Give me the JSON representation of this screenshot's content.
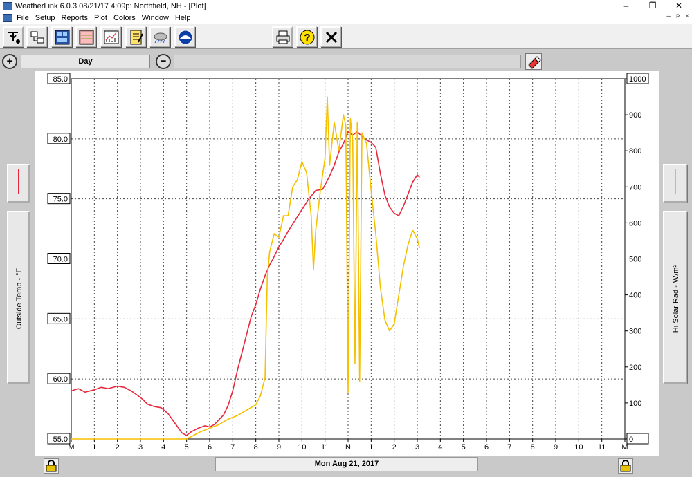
{
  "window": {
    "title": "WeatherLink 6.0.3  08/21/17   4:09p: Northfield, NH - [Plot]",
    "minimize": "–",
    "restore": "❐",
    "close": "✕"
  },
  "menu": {
    "items": [
      "File",
      "Setup",
      "Reports",
      "Plot",
      "Colors",
      "Window",
      "Help"
    ],
    "child_controls": [
      "–",
      "ᴘ",
      "×"
    ]
  },
  "toolbar": {
    "icons": [
      "station-pointer-icon",
      "network-icon",
      "bulletin-icon",
      "browse-table-icon",
      "plot-icon",
      "notes-icon",
      "weather-cloud-icon",
      "noaa-icon",
      "print-icon",
      "help-icon",
      "close-icon"
    ]
  },
  "range": {
    "zoom_in": "+",
    "zoom_out": "−",
    "period": "Day",
    "range_value": ""
  },
  "left_panel": {
    "label": "Outside Temp - °F",
    "color": "#e8283c"
  },
  "right_panel": {
    "label": "Hi Solar Rad - W/m²",
    "color": "#f5c000"
  },
  "date": "Mon Aug 21, 2017",
  "colors": {
    "temp": "#e8283c",
    "solar": "#f5c000",
    "grid": "#444444"
  },
  "chart_data": {
    "type": "line",
    "x_tick_labels": [
      "M",
      "1",
      "2",
      "3",
      "4",
      "5",
      "6",
      "7",
      "8",
      "9",
      "10",
      "11",
      "N",
      "1",
      "2",
      "3",
      "4",
      "5",
      "6",
      "7",
      "8",
      "9",
      "10",
      "11",
      "M"
    ],
    "x_unit": "hour of day",
    "xlim": [
      0,
      24
    ],
    "y_left": {
      "label": "Outside Temp - °F",
      "ylim": [
        55,
        85
      ],
      "ticks": [
        "55.0",
        "60.0",
        "65.0",
        "70.0",
        "75.0",
        "80.0",
        "85.0"
      ]
    },
    "y_right": {
      "label": "Hi Solar Rad - W/m²",
      "ylim": [
        0,
        1000
      ],
      "ticks": [
        "0",
        "100",
        "200",
        "300",
        "400",
        "500",
        "600",
        "700",
        "800",
        "900",
        "1000"
      ]
    },
    "grid": true,
    "series": [
      {
        "name": "Outside Temp - °F",
        "axis": "left",
        "color": "#e8283c",
        "x": [
          0.0,
          0.3,
          0.6,
          1.0,
          1.3,
          1.6,
          2.0,
          2.3,
          2.6,
          2.9,
          3.1,
          3.3,
          3.6,
          3.9,
          4.2,
          4.5,
          4.8,
          5.0,
          5.2,
          5.5,
          5.8,
          6.0,
          6.2,
          6.4,
          6.6,
          6.8,
          7.0,
          7.2,
          7.4,
          7.6,
          7.8,
          8.0,
          8.2,
          8.4,
          8.6,
          8.8,
          9.0,
          9.2,
          9.4,
          9.6,
          9.8,
          10.0,
          10.3,
          10.6,
          10.9,
          11.2,
          11.4,
          11.6,
          11.8,
          12.0,
          12.2,
          12.4,
          12.6,
          12.8,
          13.0,
          13.2,
          13.4,
          13.6,
          13.8,
          14.0,
          14.2,
          14.4,
          14.6,
          14.8,
          15.0,
          15.1
        ],
        "values": [
          59.0,
          59.2,
          58.9,
          59.1,
          59.3,
          59.2,
          59.4,
          59.3,
          59.0,
          58.6,
          58.3,
          57.9,
          57.7,
          57.6,
          57.1,
          56.3,
          55.5,
          55.3,
          55.6,
          55.9,
          56.1,
          56.0,
          56.2,
          56.6,
          57.0,
          57.8,
          59.0,
          60.7,
          62.2,
          63.7,
          65.2,
          66.2,
          67.5,
          68.6,
          69.5,
          70.2,
          71.0,
          71.6,
          72.3,
          72.9,
          73.5,
          74.1,
          75.0,
          75.7,
          75.8,
          76.9,
          77.8,
          78.9,
          79.6,
          80.6,
          80.3,
          80.6,
          80.2,
          79.9,
          79.7,
          79.3,
          77.1,
          75.3,
          74.3,
          73.8,
          73.6,
          74.4,
          75.4,
          76.4,
          77.0,
          76.8
        ]
      },
      {
        "name": "Hi Solar Rad - W/m²",
        "axis": "right",
        "color": "#f5c000",
        "x": [
          0.0,
          1.0,
          2.0,
          3.0,
          4.0,
          5.0,
          5.3,
          5.6,
          6.0,
          6.4,
          6.8,
          7.2,
          7.6,
          8.0,
          8.2,
          8.4,
          8.5,
          8.6,
          8.8,
          9.0,
          9.2,
          9.4,
          9.6,
          9.8,
          10.0,
          10.2,
          10.4,
          10.5,
          10.6,
          10.8,
          11.0,
          11.1,
          11.2,
          11.4,
          11.6,
          11.8,
          11.9,
          12.0,
          12.1,
          12.2,
          12.3,
          12.4,
          12.5,
          12.6,
          12.8,
          13.0,
          13.2,
          13.4,
          13.6,
          13.8,
          14.0,
          14.2,
          14.4,
          14.6,
          14.8,
          15.0,
          15.1
        ],
        "values": [
          0,
          0,
          0,
          0,
          0,
          0,
          10,
          20,
          30,
          40,
          55,
          65,
          80,
          95,
          120,
          170,
          450,
          520,
          570,
          560,
          620,
          620,
          700,
          720,
          770,
          740,
          620,
          470,
          580,
          690,
          780,
          950,
          760,
          880,
          800,
          900,
          870,
          130,
          890,
          830,
          210,
          880,
          160,
          850,
          820,
          690,
          570,
          420,
          330,
          300,
          320,
          400,
          480,
          540,
          580,
          555,
          530
        ]
      }
    ]
  }
}
